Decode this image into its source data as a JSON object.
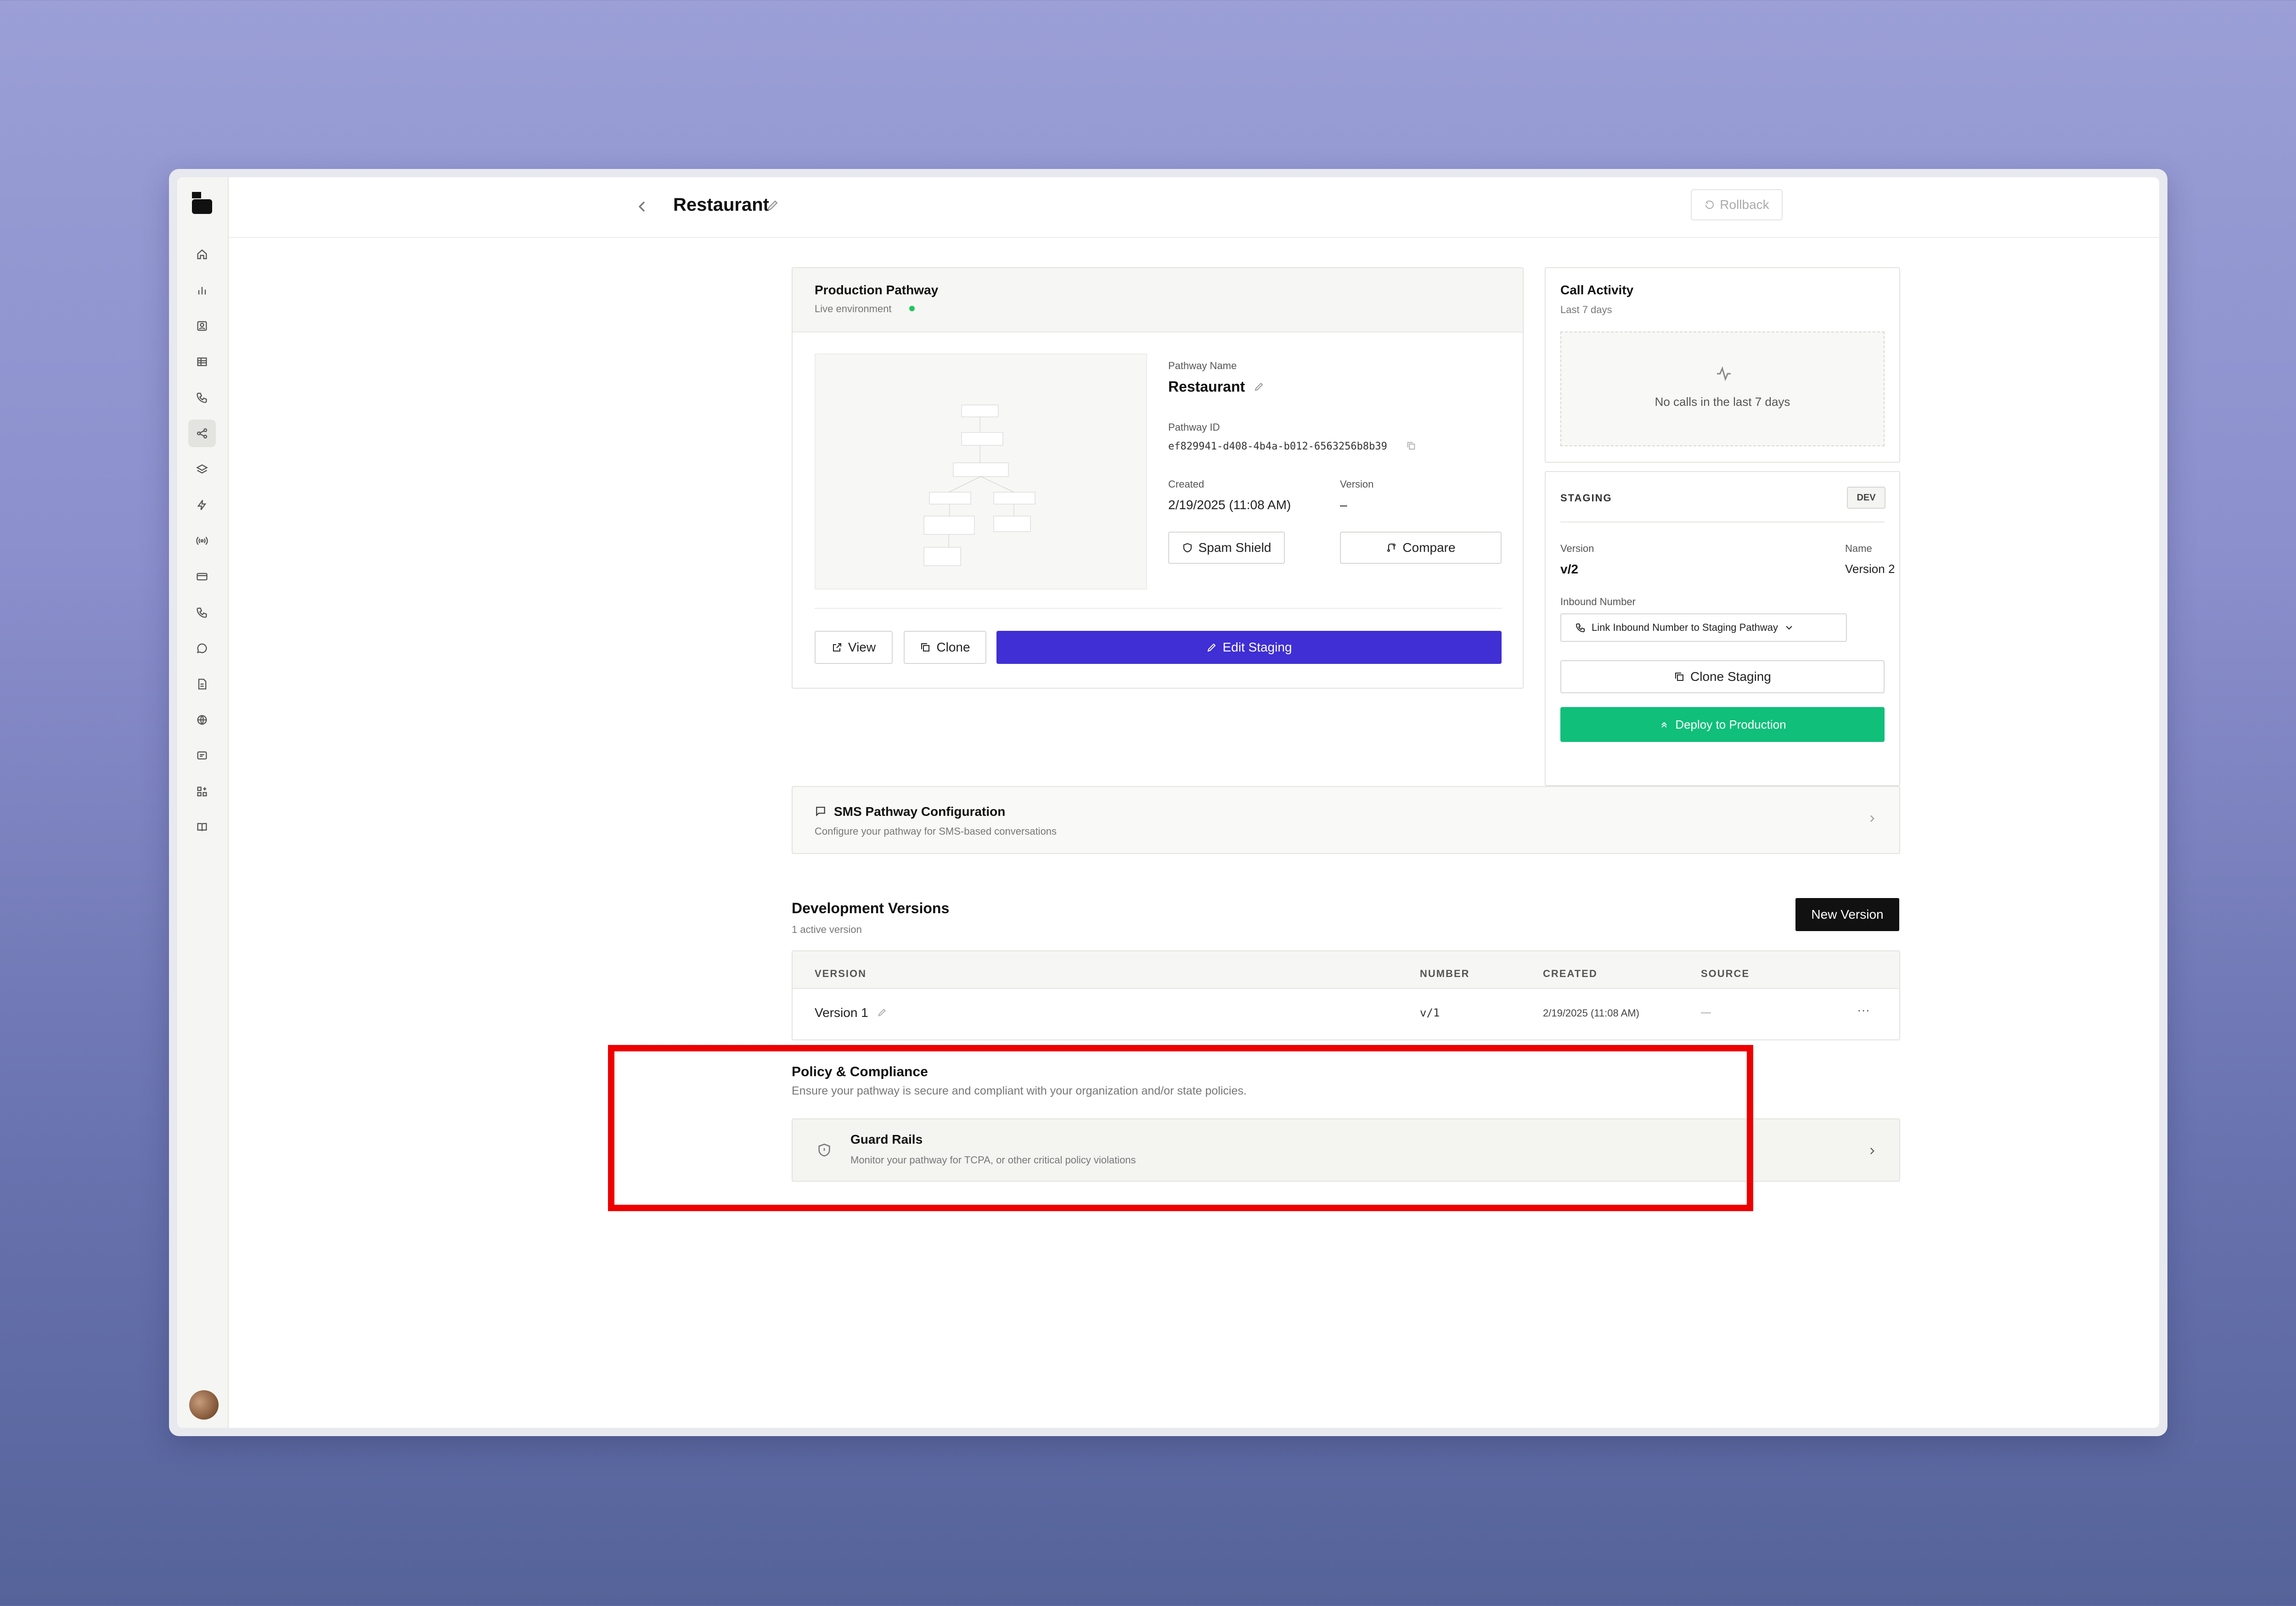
{
  "page": {
    "title": "Restaurant",
    "rollback_label": "Rollback"
  },
  "production": {
    "heading": "Production Pathway",
    "env_label": "Live environment",
    "pathway_name_label": "Pathway Name",
    "pathway_name": "Restaurant",
    "pathway_id_label": "Pathway ID",
    "pathway_id": "ef829941-d408-4b4a-b012-6563256b8b39",
    "created_label": "Created",
    "created_value": "2/19/2025 (11:08 AM)",
    "version_label": "Version",
    "version_value": "–",
    "spam_shield_label": "Spam Shield",
    "compare_label": "Compare",
    "view_label": "View",
    "clone_label": "Clone",
    "edit_staging_label": "Edit Staging"
  },
  "call_activity": {
    "heading": "Call Activity",
    "subheading": "Last 7 days",
    "empty_text": "No calls in the last 7 days"
  },
  "staging": {
    "heading": "STAGING",
    "badge": "DEV",
    "version_label": "Version",
    "version_value": "v/2",
    "name_label": "Name",
    "name_value": "Version 2",
    "inbound_label": "Inbound Number",
    "inbound_select": "Link Inbound Number to Staging Pathway",
    "clone_label": "Clone Staging",
    "deploy_label": "Deploy to Production"
  },
  "sms": {
    "title": "SMS Pathway Configuration",
    "subtitle": "Configure your pathway for SMS-based conversations"
  },
  "dev_versions": {
    "title": "Development Versions",
    "subtitle": "1 active version",
    "new_button": "New Version",
    "columns": [
      "VERSION",
      "NUMBER",
      "CREATED",
      "SOURCE"
    ],
    "rows": [
      {
        "version": "Version 1",
        "number": "v/1",
        "created": "2/19/2025 (11:08 AM)",
        "source": "—",
        "more": "···"
      }
    ]
  },
  "policy": {
    "title": "Policy & Compliance",
    "subtitle": "Ensure your pathway is secure and compliant with your organization and/or state policies.",
    "guard_title": "Guard Rails",
    "guard_subtitle": "Monitor your pathway for TCPA, or other critical policy violations"
  },
  "colors": {
    "accent_indigo": "#3f2fd4",
    "deploy_green": "#0fbf7a",
    "live_dot": "#22c55e",
    "highlight_red": "#ee0000"
  },
  "sidebar_icons": [
    "home-icon",
    "analytics-icon",
    "contacts-icon",
    "table-icon",
    "calls-icon",
    "pathway-icon",
    "layers-icon",
    "bolt-icon",
    "broadcast-icon",
    "billing-icon",
    "phone-icon",
    "chat-icon",
    "document-icon",
    "globe-icon",
    "message-icon",
    "widgets-icon",
    "book-icon"
  ]
}
